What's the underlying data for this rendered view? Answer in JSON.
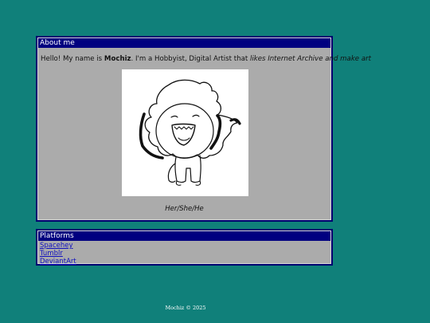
{
  "about": {
    "title": "About me",
    "intro_prefix": "Hello! My name is ",
    "name": "Mochiz",
    "intro_middle": ". I'm a Hobbyist, Digital Artist that ",
    "intro_italic": "likes Internet Archive and make art",
    "image_alt": "Mochiz character drawing",
    "pronouns": "Her/She/He"
  },
  "platforms": {
    "title": "Platforms",
    "links": [
      "Spacehey",
      "Tumblr",
      "DeviantArt"
    ]
  },
  "footer": {
    "text": "Mochiz © 2025"
  },
  "colors": {
    "background": "#10807a",
    "panel": "#ababab",
    "titlebar": "#000080",
    "link": "#1010c0"
  }
}
